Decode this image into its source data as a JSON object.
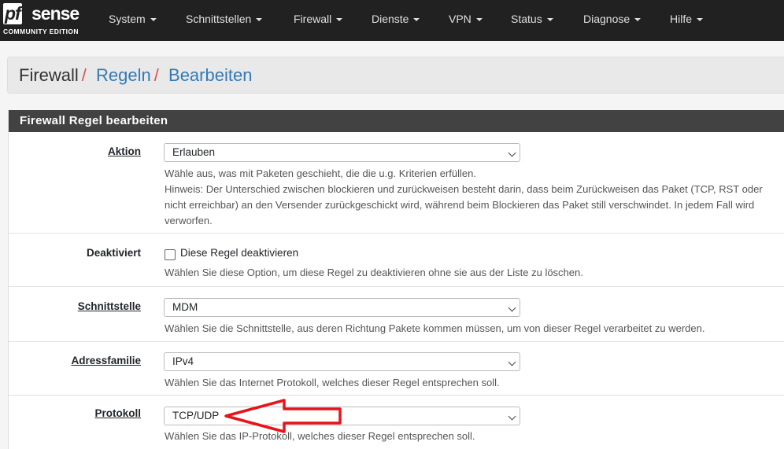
{
  "logo": {
    "pf": "pf",
    "sense": "sense",
    "edition": "COMMUNITY EDITION"
  },
  "nav": {
    "items": [
      {
        "label": "System"
      },
      {
        "label": "Schnittstellen"
      },
      {
        "label": "Firewall"
      },
      {
        "label": "Dienste"
      },
      {
        "label": "VPN"
      },
      {
        "label": "Status"
      },
      {
        "label": "Diagnose"
      },
      {
        "label": "Hilfe"
      }
    ]
  },
  "breadcrumb": {
    "home": "Firewall",
    "sep": "/",
    "level1": "Regeln",
    "level2": "Bearbeiten"
  },
  "panel": {
    "title": "Firewall Regel bearbeiten",
    "fields": {
      "aktion": {
        "label": "Aktion",
        "value": "Erlauben",
        "help1": "Wähle aus, was mit Paketen geschieht, die die u.g. Kriterien erfüllen.",
        "help2": "Hinweis: Der Unterschied zwischen blockieren und zurückweisen besteht darin, dass beim Zurückweisen das Paket (TCP, RST oder",
        "help3": "nicht erreichbar) an den Versender zurückgeschickt wird, während beim Blockieren das Paket still verschwindet. In jedem Fall wird",
        "help4": "verworfen."
      },
      "deaktiviert": {
        "label": "Deaktiviert",
        "checkbox_label": "Diese Regel deaktivieren",
        "help": "Wählen Sie diese Option, um diese Regel zu deaktivieren ohne sie aus der Liste zu löschen."
      },
      "schnittstelle": {
        "label": "Schnittstelle",
        "value": "MDM",
        "help": "Wählen Sie die Schnittstelle, aus deren Richtung Pakete kommen müssen, um von dieser Regel verarbeitet zu werden."
      },
      "adressfamilie": {
        "label": "Adressfamilie",
        "value": "IPv4",
        "help": "Wählen Sie das Internet Protokoll, welches dieser Regel entsprechen soll."
      },
      "protokoll": {
        "label": "Protokoll",
        "value": "TCP/UDP",
        "help": "Wählen Sie das IP-Protokoll, welches dieser Regel entsprechen soll."
      }
    }
  },
  "annotation": {
    "arrow_color": "#e8141b"
  }
}
